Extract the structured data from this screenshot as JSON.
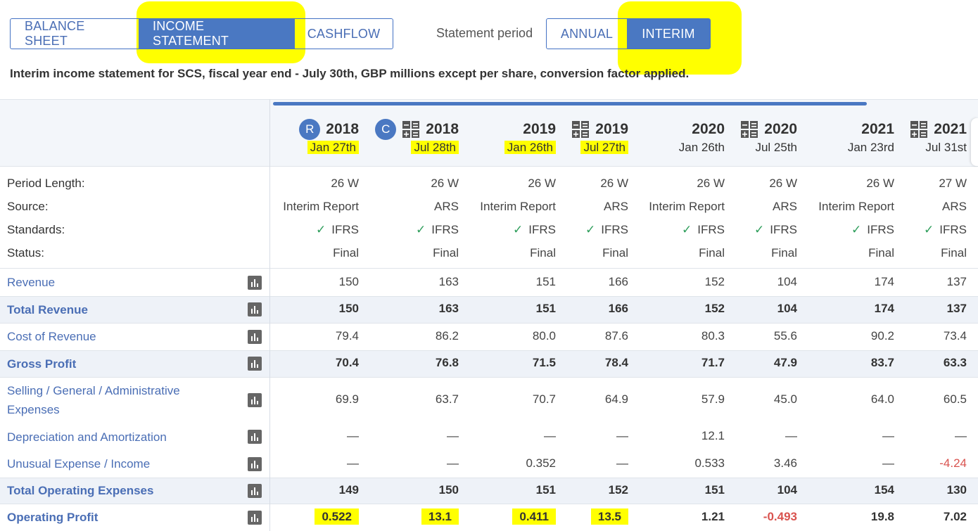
{
  "tabs": {
    "statement": [
      "BALANCE SHEET",
      "INCOME STATEMENT",
      "CASHFLOW"
    ],
    "period_label": "Statement period",
    "period": [
      "ANNUAL",
      "INTERIM"
    ]
  },
  "description": "Interim income statement for SCS, fiscal year end - July 30th, GBP millions except per share, conversion factor applied.",
  "columns": [
    {
      "badge": "R",
      "year": "2018",
      "date": "Jan 27th"
    },
    {
      "badge": "C",
      "icon": "calculator-icon",
      "year": "2018",
      "date": "Jul 28th"
    },
    {
      "year": "2019",
      "date": "Jan 26th"
    },
    {
      "icon": "calculator-icon",
      "year": "2019",
      "date": "Jul 27th"
    },
    {
      "year": "2020",
      "date": "Jan 26th"
    },
    {
      "icon": "calculator-icon",
      "year": "2020",
      "date": "Jul 25th"
    },
    {
      "year": "2021",
      "date": "Jan 23rd"
    },
    {
      "icon": "calculator-icon",
      "year": "2021",
      "date": "Jul 31st"
    }
  ],
  "meta": {
    "labels": [
      "Period Length:",
      "Source:",
      "Standards:",
      "Status:"
    ],
    "period_length": [
      "26 W",
      "26 W",
      "26 W",
      "26 W",
      "26 W",
      "26 W",
      "26 W",
      "27 W"
    ],
    "source": [
      "Interim Report",
      "ARS",
      "Interim Report",
      "ARS",
      "Interim Report",
      "ARS",
      "Interim Report",
      "ARS"
    ],
    "standards": [
      "IFRS",
      "IFRS",
      "IFRS",
      "IFRS",
      "IFRS",
      "IFRS",
      "IFRS",
      "IFRS"
    ],
    "status": [
      "Final",
      "Final",
      "Final",
      "Final",
      "Final",
      "Final",
      "Final",
      "Final"
    ]
  },
  "rows": [
    {
      "label": "Revenue",
      "values": [
        "150",
        "163",
        "151",
        "166",
        "152",
        "104",
        "174",
        "137"
      ]
    },
    {
      "label": "Total Revenue",
      "values": [
        "150",
        "163",
        "151",
        "166",
        "152",
        "104",
        "174",
        "137"
      ]
    },
    {
      "label": "Cost of Revenue",
      "values": [
        "79.4",
        "86.2",
        "80.0",
        "87.6",
        "80.3",
        "55.6",
        "90.2",
        "73.4"
      ]
    },
    {
      "label": "Gross Profit",
      "values": [
        "70.4",
        "76.8",
        "71.5",
        "78.4",
        "71.7",
        "47.9",
        "83.7",
        "63.3"
      ]
    },
    {
      "label_line1": "Selling / General / Administrative",
      "label_line2": "Expenses",
      "values": [
        "69.9",
        "63.7",
        "70.7",
        "64.9",
        "57.9",
        "45.0",
        "64.0",
        "60.5"
      ]
    },
    {
      "label": "Depreciation and Amortization",
      "values": [
        "—",
        "—",
        "—",
        "—",
        "12.1",
        "—",
        "—",
        "—"
      ]
    },
    {
      "label": "Unusual Expense / Income",
      "values": [
        "—",
        "—",
        "0.352",
        "—",
        "0.533",
        "3.46",
        "—",
        "-4.24"
      ]
    },
    {
      "label": "Total Operating Expenses",
      "values": [
        "149",
        "150",
        "151",
        "152",
        "151",
        "104",
        "154",
        "130"
      ]
    },
    {
      "label": "Operating Profit",
      "values": [
        "0.522",
        "13.1",
        "0.411",
        "13.5",
        "1.21",
        "-0.493",
        "19.8",
        "7.02"
      ]
    }
  ],
  "colors": {
    "accent": "#4a78c2",
    "highlight": "#ffff00",
    "negative": "#d9534f",
    "check": "#2e9e5b"
  }
}
